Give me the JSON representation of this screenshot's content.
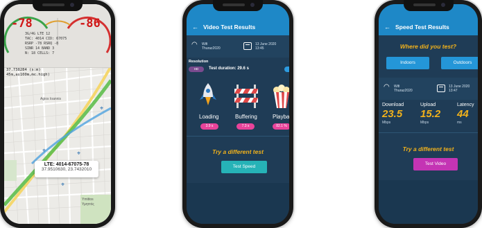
{
  "map_phone": {
    "gauge_left": "-78",
    "gauge_right": "-86",
    "dash_lines": [
      "3G/4G  LTE  12",
      "TAC: 4014  CID: 67075",
      "RSRP -78  RSRQ -8",
      "SINR 14  BAND 3",
      "N: 18  CELLS: 7",
      "37.738284 (s:m)",
      "45m,as100m,mc.high)"
    ],
    "coord_line_1": "37.738284 (s:m)",
    "coord_line_2": "45m,as100m,mc.high)",
    "place_1": "Agios Ioannis",
    "place_2": "Ymittos",
    "place_3": "Υμηττός",
    "lte_title": "LTE: 4014-67075-78",
    "lte_coords": "37.9510630, 23.7432010"
  },
  "video_phone": {
    "title": "Video Test Results",
    "back_icon": "←",
    "wifi_label": "Wifi",
    "wifi_name": "Thuraz2020",
    "date": "13 June 2020",
    "time": "13:45",
    "resolution_label": "Resolution",
    "resolution_chip": "HD",
    "test_duration": "Test duration: 29.6 s",
    "metrics": [
      {
        "icon": "rocket-icon",
        "label": "Loading",
        "value": "3.9 s"
      },
      {
        "icon": "barrier-icon",
        "label": "Buffering",
        "value": "7.3 s"
      },
      {
        "icon": "popcorn-icon",
        "label": "Playback",
        "value": "82.1 %"
      }
    ],
    "try_text": "Try a different test",
    "button": "Test Speed"
  },
  "speed_phone": {
    "title": "Speed Test Results",
    "back_icon": "←",
    "question": "Where did you test?",
    "indoors": "Indoors",
    "outdoors": "Outdoors",
    "wifi_label": "Wifi",
    "wifi_name": "Thuraz2020",
    "date": "13 June 2020",
    "time": "13:47",
    "download_label": "Download",
    "download_value": "23.5",
    "download_unit": "Mbps",
    "upload_label": "Upload",
    "upload_value": "15.2",
    "upload_unit": "Mbps",
    "latency_label": "Latency",
    "latency_value": "44",
    "latency_unit": "ms",
    "try_text": "Try a different test",
    "button": "Test Video"
  },
  "colors": {
    "app_bg": "#1f3c56",
    "topbar": "#1e88c7",
    "accent_yellow": "#f2b21b",
    "pill_pink": "#e8439a",
    "button_teal": "#26b3b7",
    "button_magenta": "#c434b4"
  }
}
